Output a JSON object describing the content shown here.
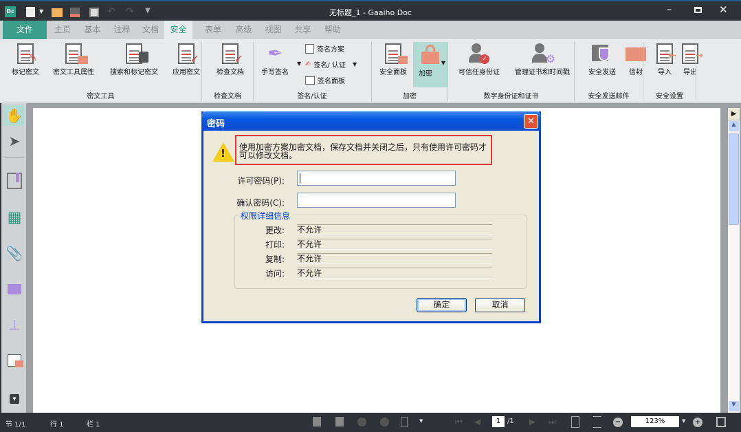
{
  "window": {
    "title": "无标题_1 - Gaaiho Doc",
    "app_logo": "Dc"
  },
  "tabs": [
    {
      "label": "文件"
    },
    {
      "label": "主页"
    },
    {
      "label": "基本"
    },
    {
      "label": "注释"
    },
    {
      "label": "文档"
    },
    {
      "label": "安全",
      "active": true
    },
    {
      "label": "表单"
    },
    {
      "label": "高级"
    },
    {
      "label": "视图"
    },
    {
      "label": "共享"
    },
    {
      "label": "帮助"
    }
  ],
  "ribbon": {
    "buttons": {
      "mark_redact": "标记密文",
      "redact_props": "密文工具属性",
      "search_redact": "搜索和标记密文",
      "apply_redact": "应用密文",
      "inspect_doc": "检查文档",
      "handwrite_sign": "手写签名",
      "security_panel": "安全面板",
      "encrypt": "加密",
      "trusted_ids": "可信任身份证",
      "manage_certs": "管理证书和时间戳",
      "secure_send": "安全发送",
      "envelope": "信封",
      "import": "导入",
      "export": "导出"
    },
    "small": {
      "sign_scheme": "签名方案",
      "sign_verify": "签名/ 认证",
      "sign_panel": "签名面板"
    },
    "groups": {
      "redact": "密文工具",
      "inspect": "检查文档",
      "sign": "签名/认证",
      "encrypt": "加密",
      "digital_id": "数字身份证和证书",
      "secure_mail": "安全发送邮件",
      "security_settings": "安全设置"
    }
  },
  "dialog": {
    "title": "密码",
    "message": "使用加密方案加密文档，保存文档并关闭之后，只有使用许可密码才可以修改文档。",
    "permission_password_label": "许可密码(P):",
    "permission_password_value": "",
    "confirm_password_label": "确认密码(C):",
    "confirm_password_value": "",
    "group_title": "权限详细信息",
    "permissions": [
      {
        "label": "更改:",
        "value": "不允许"
      },
      {
        "label": "打印:",
        "value": "不允许"
      },
      {
        "label": "复制:",
        "value": "不允许"
      },
      {
        "label": "访问:",
        "value": "不允许"
      }
    ],
    "ok": "确定",
    "cancel": "取消",
    "highlight_color": "#e8323c"
  },
  "status": {
    "section": "节 1/1",
    "row": "行 1",
    "col": "栏 1",
    "page_input": "1",
    "page_total": "/1",
    "zoom": "123%"
  },
  "colors": {
    "accent": "#3a9e88",
    "titlebar": "#2f3337"
  }
}
